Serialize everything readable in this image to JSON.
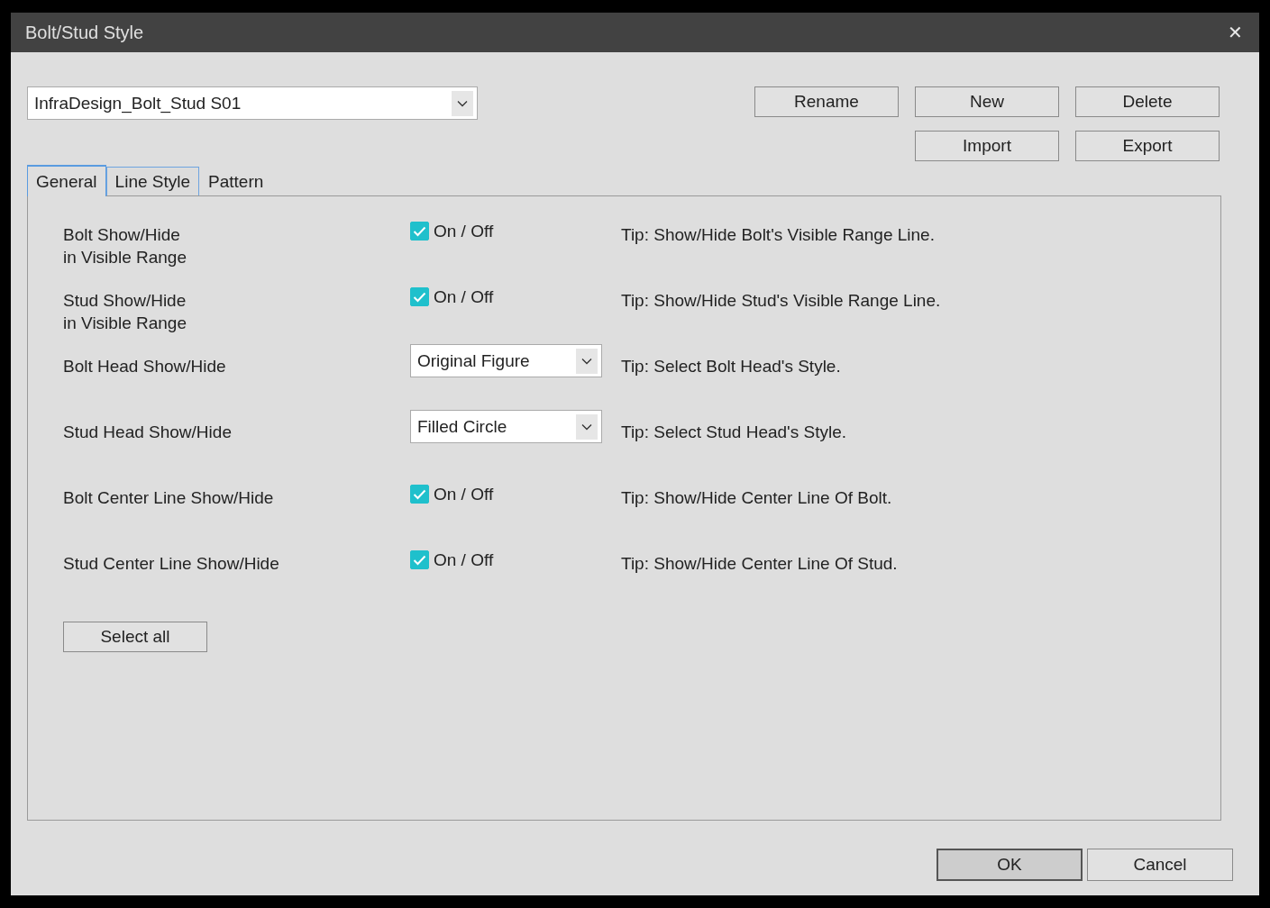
{
  "window": {
    "title": "Bolt/Stud Style",
    "close": "✕"
  },
  "style_select": {
    "value": "InfraDesign_Bolt_Stud S01"
  },
  "actions": [
    [
      "Rename",
      "New",
      "Delete"
    ],
    [
      "Import",
      "Export"
    ]
  ],
  "tabs": [
    {
      "label": "General",
      "selected": true
    },
    {
      "label": "Line Style",
      "selected": false
    },
    {
      "label": "Pattern",
      "selected": false
    }
  ],
  "rows": [
    {
      "kind": "checkbox",
      "label": "Bolt Show/Hide\nin Visible Range",
      "checked": true,
      "option": "On / Off",
      "tip": "Tip: Show/Hide Bolt's Visible Range Line."
    },
    {
      "kind": "checkbox",
      "label": "Stud Show/Hide\nin Visible Range",
      "checked": true,
      "option": "On / Off",
      "tip": "Tip: Show/Hide Stud's Visible Range Line."
    },
    {
      "kind": "dropdown",
      "label": "Bolt Head Show/Hide",
      "value": "Original Figure",
      "tip": "Tip: Select Bolt Head's Style."
    },
    {
      "kind": "dropdown",
      "label": "Stud Head Show/Hide",
      "value": "Filled Circle",
      "tip": "Tip: Select Stud Head's Style."
    },
    {
      "kind": "checkbox",
      "label": "Bolt Center Line Show/Hide",
      "checked": true,
      "option": "On / Off",
      "tip": "Tip: Show/Hide Center Line Of Bolt."
    },
    {
      "kind": "checkbox",
      "label": "Stud Center Line Show/Hide",
      "checked": true,
      "option": "On / Off",
      "tip": "Tip: Show/Hide Center Line Of Stud."
    }
  ],
  "select_all": "Select all",
  "footer": [
    {
      "label": "OK",
      "default": true
    },
    {
      "label": "Cancel",
      "default": false
    }
  ]
}
